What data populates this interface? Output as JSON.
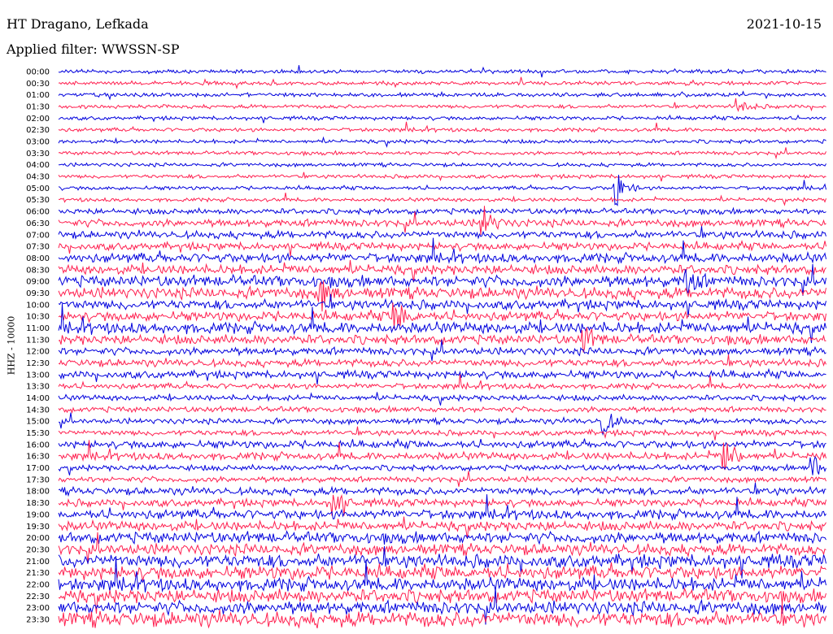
{
  "header": {
    "station": "HT Dragano, Lefkada",
    "date": "2021-10-15",
    "filter": "Applied filter: WWSSN-SP"
  },
  "axis": {
    "ylabel": "HHZ - 10000"
  },
  "colors": {
    "trace_a": "#0000dd",
    "trace_b": "#ff1f4f",
    "background": "#ffffff"
  },
  "chart_data": {
    "type": "line",
    "title": "HT Dragano, Lefkada",
    "ylabel": "HHZ - 10000",
    "rows": [
      "00:00",
      "00:30",
      "01:00",
      "01:30",
      "02:00",
      "02:30",
      "03:00",
      "03:30",
      "04:00",
      "04:30",
      "05:00",
      "05:30",
      "06:00",
      "06:30",
      "07:00",
      "07:30",
      "08:00",
      "08:30",
      "09:00",
      "09:30",
      "10:00",
      "10:30",
      "11:00",
      "11:30",
      "12:00",
      "12:30",
      "13:00",
      "13:30",
      "14:00",
      "14:30",
      "15:00",
      "15:30",
      "16:00",
      "16:30",
      "17:00",
      "17:30",
      "18:00",
      "18:30",
      "19:00",
      "19:30",
      "20:00",
      "20:30",
      "21:00",
      "21:30",
      "22:00",
      "22:30",
      "23:00",
      "23:30"
    ],
    "x_range_minutes": [
      0,
      30
    ],
    "noise_level": [
      2,
      2,
      2,
      2,
      2,
      2,
      2,
      2,
      2,
      2,
      2,
      2,
      3,
      4,
      4,
      4,
      5,
      5,
      6,
      6,
      5,
      5,
      6,
      5,
      4,
      4,
      4,
      3,
      3,
      3,
      3,
      3,
      4,
      4,
      3,
      3,
      4,
      4,
      5,
      5,
      6,
      6,
      7,
      7,
      7,
      7,
      7,
      8
    ],
    "events": [
      {
        "row": "05:00",
        "minute": 21.8,
        "amplitude": 22
      },
      {
        "row": "06:30",
        "minute": 16.6,
        "amplitude": 20
      },
      {
        "row": "09:30",
        "minute": 10.3,
        "amplitude": 16
      },
      {
        "row": "10:30",
        "minute": 13.2,
        "amplitude": 18
      },
      {
        "row": "11:30",
        "minute": 20.6,
        "amplitude": 14
      },
      {
        "row": "15:00",
        "minute": 21.3,
        "amplitude": 16
      },
      {
        "row": "16:30",
        "minute": 26.0,
        "amplitude": 28
      },
      {
        "row": "17:00",
        "minute": 29.5,
        "amplitude": 14
      },
      {
        "row": "18:30",
        "minute": 10.8,
        "amplitude": 16
      },
      {
        "row": "01:30",
        "minute": 26.6,
        "amplitude": 10
      },
      {
        "row": "09:00",
        "minute": 24.6,
        "amplitude": 14
      }
    ]
  }
}
